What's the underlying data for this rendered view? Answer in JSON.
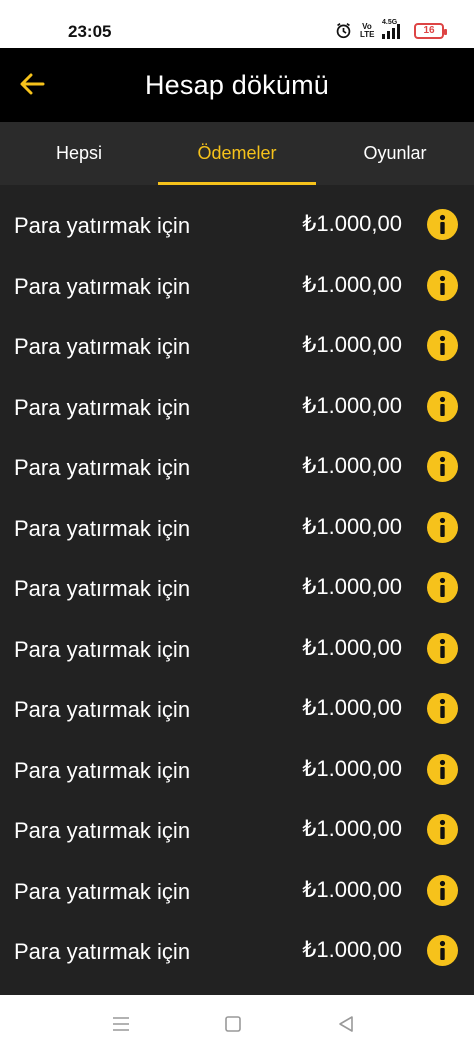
{
  "status_bar": {
    "time": "23:05",
    "volte": "Vo LTE",
    "network": "4.5G",
    "battery": "16",
    "icons": [
      "alarm-icon",
      "volte-icon",
      "signal-icon",
      "battery-icon"
    ]
  },
  "header": {
    "title": "Hesap dökümü",
    "back_icon": "arrow-left-icon",
    "accent_color": "#f6c21b"
  },
  "tabs": [
    {
      "label": "Hepsi",
      "active": false
    },
    {
      "label": "Ödemeler",
      "active": true
    },
    {
      "label": "Oyunlar",
      "active": false
    }
  ],
  "transactions": [
    {
      "label": "Para yatırmak için",
      "amount": "₺1.000,00"
    },
    {
      "label": "Para yatırmak için",
      "amount": "₺1.000,00"
    },
    {
      "label": "Para yatırmak için",
      "amount": "₺1.000,00"
    },
    {
      "label": "Para yatırmak için",
      "amount": "₺1.000,00"
    },
    {
      "label": "Para yatırmak için",
      "amount": "₺1.000,00"
    },
    {
      "label": "Para yatırmak için",
      "amount": "₺1.000,00"
    },
    {
      "label": "Para yatırmak için",
      "amount": "₺1.000,00"
    },
    {
      "label": "Para yatırmak için",
      "amount": "₺1.000,00"
    },
    {
      "label": "Para yatırmak için",
      "amount": "₺1.000,00"
    },
    {
      "label": "Para yatırmak için",
      "amount": "₺1.000,00"
    },
    {
      "label": "Para yatırmak için",
      "amount": "₺1.000,00"
    },
    {
      "label": "Para yatırmak için",
      "amount": "₺1.000,00"
    },
    {
      "label": "Para yatırmak için",
      "amount": "₺1.000,00"
    }
  ],
  "nav_bar": {
    "icons": [
      "menu-icon",
      "home-square-icon",
      "back-triangle-icon"
    ]
  }
}
